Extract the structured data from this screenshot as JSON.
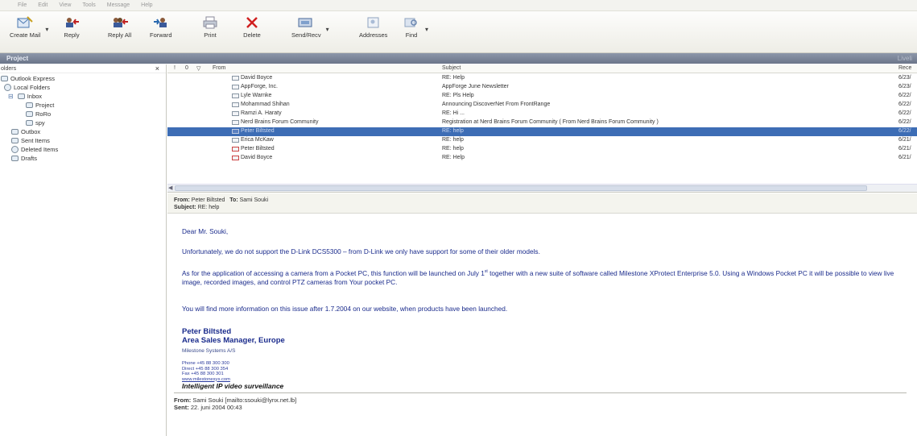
{
  "menubar": [
    "File",
    "Edit",
    "View",
    "Tools",
    "Message",
    "Help"
  ],
  "toolbar": {
    "buttons": [
      {
        "label": "Create Mail",
        "icon": "create-mail-icon"
      },
      {
        "label": "Reply",
        "icon": "reply-icon"
      },
      {
        "label": "Reply All",
        "icon": "reply-all-icon"
      },
      {
        "label": "Forward",
        "icon": "forward-icon"
      },
      {
        "label": "Print",
        "icon": "print-icon"
      },
      {
        "label": "Delete",
        "icon": "delete-icon"
      },
      {
        "label": "Send/Recv",
        "icon": "send-receive-icon"
      },
      {
        "label": "Addresses",
        "icon": "addresses-icon"
      },
      {
        "label": "Find",
        "icon": "find-icon"
      }
    ]
  },
  "titlebar": {
    "left": "Project",
    "right": "Liveli"
  },
  "folders": {
    "header": "olders",
    "close": "×",
    "items": [
      {
        "label": "Outlook Express"
      },
      {
        "label": "Local Folders"
      },
      {
        "label": "Inbox"
      },
      {
        "label": "Project"
      },
      {
        "label": "RoRo"
      },
      {
        "label": "spy"
      },
      {
        "label": "Outbox"
      },
      {
        "label": "Sent Items"
      },
      {
        "label": "Deleted Items"
      },
      {
        "label": "Drafts"
      }
    ]
  },
  "messages": {
    "columns": {
      "priority": "!",
      "attach": "0",
      "flag": "▽",
      "from": "From",
      "subject": "Subject",
      "received": "Rece"
    },
    "rows": [
      {
        "from": "David Boyce",
        "subject": "RE: Help",
        "received": "6/23/"
      },
      {
        "from": "AppForge, Inc.",
        "subject": "AppForge June Newsletter",
        "received": "6/23/"
      },
      {
        "from": "Lyle Warnke",
        "subject": "RE: Pls Help",
        "received": "6/22/"
      },
      {
        "from": "Mohammad Shihan",
        "subject": "Announcing DiscoverNet From FrontRange",
        "received": "6/22/"
      },
      {
        "from": "Ramzi A. Haraty",
        "subject": "RE: Hi ...",
        "received": "6/22/"
      },
      {
        "from": "Nerd Brains Forum Community",
        "subject": "Registration at Nerd Brains Forum Community ( From Nerd Brains Forum Community )",
        "received": "6/22/"
      },
      {
        "from": "Peter Biltsted",
        "subject": "RE: help",
        "received": "6/22/",
        "selected": true
      },
      {
        "from": "Erica McKaw",
        "subject": "RE: help",
        "received": "6/21/"
      },
      {
        "from": "Peter Biltsted",
        "subject": "RE: help",
        "received": "6/21/"
      },
      {
        "from": "David Boyce",
        "subject": "RE: Help",
        "received": "6/21/"
      }
    ]
  },
  "preview": {
    "from_label": "From:",
    "from": "Peter Biltsted",
    "to_label": "To:",
    "to": "Sami Souki",
    "subject_label": "Subject:",
    "subject": "RE: help",
    "greeting": "Dear Mr. Souki,",
    "p1": "Unfortunately, we do not support the D-Link DCS5300 – from D-Link we only have support for some of their older models.",
    "p2a": "As for the application of accessing a camera from a Pocket PC, this function will be launched on July 1",
    "p2sup": "st",
    "p2b": " together with a new suite of software called Milestone XProtect Enterprise 5.0. Using a Windows Pocket PC it will be possible to view live image, recorded images, and control PTZ cameras from Your pocket PC.",
    "p3": "You will find more information on this issue after 1.7.2004 on our website, when products have been launched.",
    "sig_name": "Peter Biltsted",
    "sig_title": "Area Sales Manager, Europe",
    "sig_company": "Milestone Systems A/S",
    "phone": "Phone +45 88 300 300",
    "direct": "Direct +45 88 300 354",
    "fax": "Fax     +45 88 300 301",
    "web": "www.milestonesys.com",
    "tagline": "Intelligent IP video surveillance",
    "fwd_from_label": "From:",
    "fwd_from": "Sami Souki [mailto:ssouki@lynx.net.lb]",
    "fwd_sent_label": "Sent:",
    "fwd_sent": "22. juni 2004 00:43"
  }
}
